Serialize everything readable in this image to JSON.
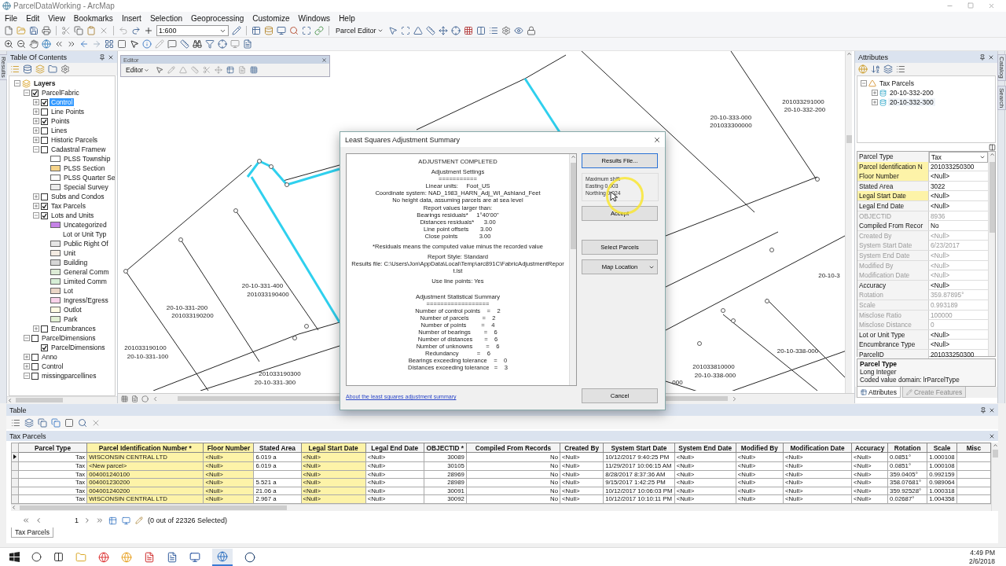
{
  "window": {
    "title": "ParcelDataWorking - ArcMap"
  },
  "menu": [
    "File",
    "Edit",
    "View",
    "Bookmarks",
    "Insert",
    "Selection",
    "Geoprocessing",
    "Customize",
    "Windows",
    "Help"
  ],
  "toolbar": {
    "scale": "1:600",
    "parcel_editor": "Parcel Editor"
  },
  "side_tabs": {
    "left": "Results",
    "right": [
      "Catalog",
      "Search"
    ]
  },
  "toc": {
    "title": "Table Of Contents",
    "tree": [
      {
        "label": "Layers",
        "kind": "group",
        "expanded": true,
        "children": [
          {
            "label": "ParcelFabric",
            "kind": "layer",
            "checked": true,
            "expanded": true,
            "selected": false,
            "children": [
              {
                "label": "Control",
                "kind": "layer",
                "checked": true,
                "expanded": false,
                "selected": true
              },
              {
                "label": "Line Points",
                "kind": "layer",
                "checked": false,
                "expanded": false,
                "selected": false
              },
              {
                "label": "Points",
                "kind": "layer",
                "checked": true,
                "expanded": false,
                "selected": false
              },
              {
                "label": "Lines",
                "kind": "layer",
                "checked": false,
                "expanded": false,
                "selected": false
              },
              {
                "label": "Historic Parcels",
                "kind": "layer",
                "checked": false,
                "expanded": false,
                "selected": false
              },
              {
                "label": "Cadastral Framew",
                "kind": "layer",
                "checked": false,
                "expanded": true,
                "selected": false,
                "children": [
                  {
                    "label": "PLSS Township",
                    "kind": "legend",
                    "color": "#ffffff"
                  },
                  {
                    "label": "PLSS Section",
                    "kind": "legend",
                    "color": "#f7d48a"
                  },
                  {
                    "label": "PLSS Quarter Se",
                    "kind": "legend",
                    "color": "#fdfdfd"
                  },
                  {
                    "label": "Special Survey",
                    "kind": "legend",
                    "color": "#ececec"
                  }
                ]
              },
              {
                "label": "Subs and Condos",
                "kind": "layer",
                "checked": false,
                "expanded": false,
                "selected": false
              },
              {
                "label": "Tax Parcels",
                "kind": "layer",
                "checked": true,
                "expanded": false,
                "selected": false
              },
              {
                "label": "Lots and Units",
                "kind": "layer",
                "checked": true,
                "expanded": true,
                "selected": false,
                "children": [
                  {
                    "label": "Uncategorized",
                    "kind": "legend",
                    "color": "#c583e6"
                  },
                  {
                    "label": "Lot or Unit Typ",
                    "kind": "heading"
                  },
                  {
                    "label": "Public Right Of",
                    "kind": "legend",
                    "color": "#e6e6e6"
                  },
                  {
                    "label": "Unit",
                    "kind": "legend",
                    "color": "#f4ebe2"
                  },
                  {
                    "label": "Building",
                    "kind": "legend",
                    "color": "#d6d6d6"
                  },
                  {
                    "label": "General Comm",
                    "kind": "legend",
                    "color": "#dcebd6"
                  },
                  {
                    "label": "Limited Comm",
                    "kind": "legend",
                    "color": "#d6eed6"
                  },
                  {
                    "label": "Lot",
                    "kind": "legend",
                    "color": "#ead6c6"
                  },
                  {
                    "label": "Ingress/Egress",
                    "kind": "legend",
                    "color": "#f9d2ea"
                  },
                  {
                    "label": "Outlot",
                    "kind": "legend",
                    "color": "#fffbe4"
                  },
                  {
                    "label": "Park",
                    "kind": "legend",
                    "color": "#e2efd4"
                  }
                ]
              },
              {
                "label": "Encumbrances",
                "kind": "layer",
                "checked": false,
                "expanded": false,
                "selected": false
              }
            ]
          },
          {
            "label": "ParcelDimensions",
            "kind": "layer",
            "checked": false,
            "expanded": true,
            "selected": false,
            "children": [
              {
                "label": "ParcelDimensions",
                "kind": "layer",
                "checked": true,
                "selected": false
              }
            ]
          },
          {
            "label": "Anno",
            "kind": "layer",
            "checked": false,
            "expanded": false,
            "selected": false
          },
          {
            "label": "Control",
            "kind": "layer",
            "checked": false,
            "expanded": false,
            "selected": false
          },
          {
            "label": "missingparcellines",
            "kind": "layer",
            "checked": false,
            "expanded": true,
            "selected": false
          }
        ]
      }
    ]
  },
  "editor": {
    "title": "Editor",
    "menu": "Editor"
  },
  "map": {
    "labels": [
      "20-10-333-000",
      "201033300000",
      "201033291000",
      "20-10-332-200",
      "20-10-331-400",
      "201033190400",
      "20-10-331-200",
      "201033190200",
      "201033190100",
      "20-10-331-100",
      "201033190300",
      "20-10-331-300",
      "20-10-338-000",
      "201033810000",
      "20-10-338-000",
      "20-10-3",
      "000"
    ]
  },
  "dialog": {
    "title": "Least Squares Adjustment Summary",
    "report": [
      [
        "ADJUSTMENT COMPLETED"
      ],
      [
        "Adjustment Settings",
        "===========",
        "Linear units:     Foot_US",
        "Coordinate system: NAD_1983_HARN_Adj_WI_Ashland_Feet",
        "No height data, assuming parcels are at sea level",
        "Report values larger than:",
        "Bearings residuals*     1°40'00\"",
        "Distances residuals*      3.00",
        "Line point offsets       3.00",
        "Close points             3.00"
      ],
      [
        "*Residuals means the computed value minus the recorded value"
      ],
      [
        "Report Style: Standard",
        "Results file: C:\\Users\\Jon\\AppData\\Local\\Temp\\arc891C\\FabricAdjustmentReport.lst"
      ],
      [
        "Use line points: Yes"
      ],
      [
        "Adjustment Statistical Summary",
        "==================",
        "Number of control points    =    2",
        "Number of parcels        =    2",
        "Number of points         =    4",
        "Number of bearings        =    6",
        "Number of distances       =    6",
        "Number of unknowns        =    6",
        "Redundancy           =    6",
        "Bearings exceeding tolerance    =    0",
        "Distances exceeding tolerance   =    3"
      ]
    ],
    "results_button": "Results File...",
    "shift": [
      "Maximum shift",
      "Easting 0.003",
      "Northing 0.024"
    ],
    "accept": "Accept",
    "select_parcels": "Select Parcels",
    "map_location": "Map Location",
    "link": "About the least squares adjustment summary",
    "cancel": "Cancel"
  },
  "attributes": {
    "title": "Attributes",
    "tree": {
      "label": "Tax Parcels",
      "children": [
        {
          "label": "20-10-332-200",
          "selected": false
        },
        {
          "label": "20-10-332-300",
          "selected": true
        }
      ]
    },
    "fields": [
      {
        "name": "Parcel Type",
        "value": "Tax",
        "kind": "select",
        "editable": true,
        "highlighted": false
      },
      {
        "name": "Parcel Identification N",
        "value": "201033250300",
        "kind": "text",
        "editable": true,
        "highlighted": true
      },
      {
        "name": "Floor Number",
        "value": "<Null>",
        "kind": "text",
        "editable": true,
        "highlighted": true
      },
      {
        "name": "Stated Area",
        "value": "3022",
        "kind": "text",
        "editable": true,
        "highlighted": false
      },
      {
        "name": "Legal Start Date",
        "value": "<Null>",
        "kind": "text",
        "editable": true,
        "highlighted": true
      },
      {
        "name": "Legal End Date",
        "value": "<Null>",
        "kind": "text",
        "editable": true,
        "highlighted": false
      },
      {
        "name": "OBJECTID",
        "value": "8936",
        "kind": "text",
        "editable": false,
        "highlighted": false
      },
      {
        "name": "Compiled From Recor",
        "value": "No",
        "kind": "text",
        "editable": true,
        "highlighted": false
      },
      {
        "name": "Created By",
        "value": "<Null>",
        "kind": "text",
        "editable": false,
        "highlighted": false
      },
      {
        "name": "System Start Date",
        "value": "6/23/2017",
        "kind": "text",
        "editable": false,
        "highlighted": false
      },
      {
        "name": "System End Date",
        "value": "<Null>",
        "kind": "text",
        "editable": false,
        "highlighted": false
      },
      {
        "name": "Modified By",
        "value": "<Null>",
        "kind": "text",
        "editable": false,
        "highlighted": false
      },
      {
        "name": "Modification Date",
        "value": "<Null>",
        "kind": "text",
        "editable": false,
        "highlighted": false
      },
      {
        "name": "Accuracy",
        "value": "<Null>",
        "kind": "text",
        "editable": true,
        "highlighted": false
      },
      {
        "name": "Rotation",
        "value": "359.87895°",
        "kind": "text",
        "editable": false,
        "highlighted": false
      },
      {
        "name": "Scale",
        "value": "0.993189",
        "kind": "text",
        "editable": false,
        "highlighted": false
      },
      {
        "name": "Misclose Ratio",
        "value": "100000",
        "kind": "text",
        "editable": false,
        "highlighted": false
      },
      {
        "name": "Misclose Distance",
        "value": "0",
        "kind": "text",
        "editable": false,
        "highlighted": false
      },
      {
        "name": "Lot or Unit Type",
        "value": "<Null>",
        "kind": "text",
        "editable": true,
        "highlighted": false
      },
      {
        "name": "Encumbrance Type",
        "value": "<Null>",
        "kind": "text",
        "editable": true,
        "highlighted": false
      },
      {
        "name": "ParcelID",
        "value": "201033250300",
        "kind": "text",
        "editable": true,
        "highlighted": false
      }
    ],
    "description": {
      "title": "Parcel Type",
      "lines": [
        "Long Integer",
        "Coded value domain: lrParcelType"
      ]
    },
    "tabs": [
      {
        "label": "Attributes",
        "selected": true
      },
      {
        "label": "Create Features",
        "selected": false
      }
    ]
  },
  "table": {
    "title": "Table",
    "layer": "Tax Parcels",
    "columns": [
      {
        "label": "Parcel Type",
        "highlighted": false
      },
      {
        "label": "Parcel Identification Number *",
        "highlighted": true
      },
      {
        "label": "Floor Number",
        "highlighted": true
      },
      {
        "label": "Stated Area",
        "highlighted": false
      },
      {
        "label": "Legal Start Date",
        "highlighted": true
      },
      {
        "label": "Legal End Date",
        "highlighted": false
      },
      {
        "label": "OBJECTID *",
        "highlighted": false
      },
      {
        "label": "Compiled From Records",
        "highlighted": false
      },
      {
        "label": "Created By",
        "highlighted": false
      },
      {
        "label": "System Start Date",
        "highlighted": false
      },
      {
        "label": "System End Date",
        "highlighted": false
      },
      {
        "label": "Modified By",
        "highlighted": false
      },
      {
        "label": "Modification Date",
        "highlighted": false
      },
      {
        "label": "Accuracy",
        "highlighted": false
      },
      {
        "label": "Rotation",
        "highlighted": false
      },
      {
        "label": "Scale",
        "highlighted": false
      },
      {
        "label": "Misc",
        "highlighted": false
      }
    ],
    "rows": [
      {
        "current": true,
        "cells": [
          "Tax",
          "WISCONSIN CENTRAL LTD",
          "<Null>",
          "6.019 a",
          "<Null>",
          "<Null>",
          "30089",
          "No",
          "<Null>",
          "10/12/2017 9:40:25 PM",
          "<Null>",
          "<Null>",
          "<Null>",
          "<Null>",
          "0.0851°",
          "1.000108"
        ]
      },
      {
        "current": false,
        "cells": [
          "Tax",
          "<New parcel>",
          "<Null>",
          "6.019 a",
          "<Null>",
          "<Null>",
          "30105",
          "No",
          "<Null>",
          "11/29/2017 10:06:15 AM",
          "<Null>",
          "<Null>",
          "<Null>",
          "<Null>",
          "0.0851°",
          "1.000108"
        ]
      },
      {
        "current": false,
        "cells": [
          "Tax",
          "004001240100",
          "<Null>",
          null,
          "<Null>",
          "<Null>",
          "28969",
          "No",
          "<Null>",
          "8/28/2017 8:37:36 AM",
          "<Null>",
          "<Null>",
          "<Null>",
          "<Null>",
          "359.0405°",
          "0.992159"
        ]
      },
      {
        "current": false,
        "cells": [
          "Tax",
          "004001230200",
          "<Null>",
          "5.521 a",
          "<Null>",
          "<Null>",
          "28989",
          "No",
          "<Null>",
          "9/15/2017 1:42:25 PM",
          "<Null>",
          "<Null>",
          "<Null>",
          "<Null>",
          "358.07681°",
          "0.989064"
        ]
      },
      {
        "current": false,
        "cells": [
          "Tax",
          "004001240200",
          "<Null>",
          "21.06 a",
          "<Null>",
          "<Null>",
          "30091",
          "No",
          "<Null>",
          "10/12/2017 10:06:03 PM",
          "<Null>",
          "<Null>",
          "<Null>",
          "<Null>",
          "359.92528°",
          "1.000318"
        ]
      },
      {
        "current": false,
        "cells": [
          "Tax",
          "WISCONSIN CENTRAL LTD",
          "<Null>",
          "2.967 a",
          "<Null>",
          "<Null>",
          "30092",
          "No",
          "<Null>",
          "10/12/2017 10:10:11 PM",
          "<Null>",
          "<Null>",
          "<Null>",
          "<Null>",
          "0.02687°",
          "1.004358"
        ]
      }
    ],
    "page": "1",
    "status": "(0 out of 22326 Selected)",
    "tab": "Tax Parcels"
  },
  "taskbar": {
    "time": "4:49 PM",
    "date": "2/6/2018"
  }
}
